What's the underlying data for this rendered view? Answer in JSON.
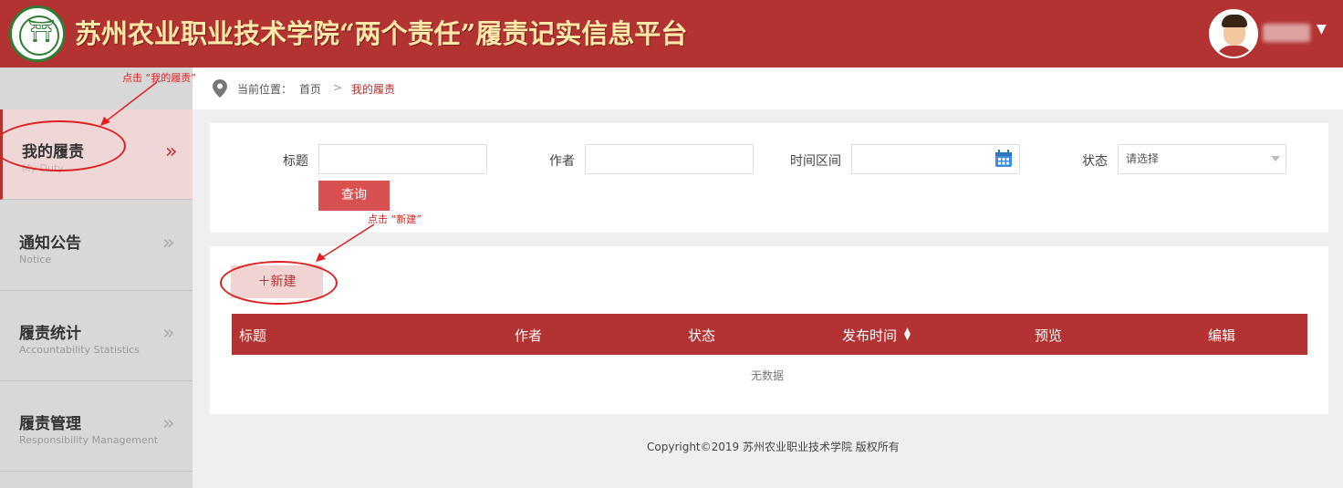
{
  "header": {
    "title": "苏州农业职业技术学院“两个责任”履责记实信息平台",
    "logo_icon": "school-emblem-icon",
    "user_menu_icon": "caret-down-icon"
  },
  "sidebar": {
    "items": [
      {
        "title": "我的履责",
        "subtitle": "My Duty",
        "active": true
      },
      {
        "title": "通知公告",
        "subtitle": "Notice",
        "active": false
      },
      {
        "title": "履责统计",
        "subtitle": "Accountability Statistics",
        "active": false
      },
      {
        "title": "履责管理",
        "subtitle": "Responsibility Management",
        "active": false
      }
    ],
    "arrow_glyph": "»"
  },
  "breadcrumb": {
    "label": "当前位置：",
    "home": "首页",
    "separator": ">",
    "current": "我的履责"
  },
  "search": {
    "title_label": "标题",
    "title_value": "",
    "author_label": "作者",
    "author_value": "",
    "range_label": "时间区间",
    "range_value": "",
    "status_label": "状态",
    "status_value": "请选择",
    "query_label": "查询"
  },
  "list": {
    "new_label": "＋新建",
    "columns": [
      "标题",
      "作者",
      "状态",
      "发布时间",
      "预览",
      "编辑"
    ],
    "sort_glyph": "⬍",
    "empty_text": "无数据"
  },
  "footer": {
    "copyright": "Copyright©2019 苏州农业职业技术学院 版权所有"
  },
  "annotations": {
    "note_my_duty": "点击 “我的履责”",
    "note_new": "点击 “新建”",
    "color": "#e02020"
  },
  "colors": {
    "brand": "#b33232",
    "title_gold": "#ffe9a8",
    "button": "#d85050"
  }
}
